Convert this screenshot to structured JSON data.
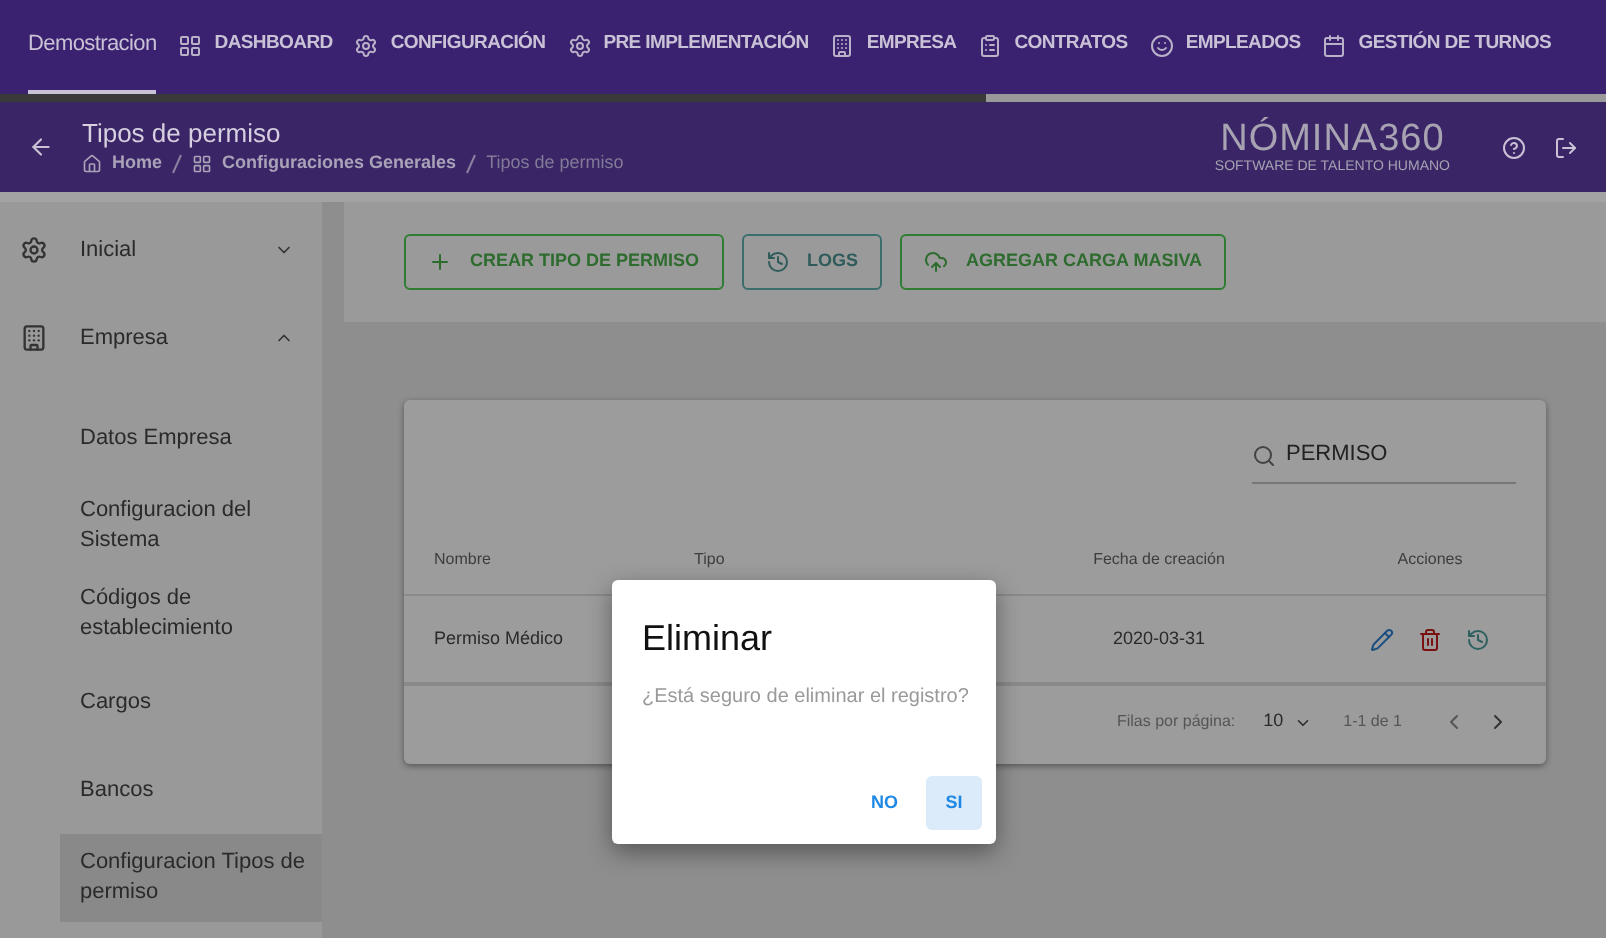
{
  "top_nav": {
    "tabs": [
      {
        "label": "Demostracion",
        "selected": true
      },
      {
        "label": "DASHBOARD",
        "selected": false
      },
      {
        "label": "CONFIGURACIÓN",
        "selected": false
      },
      {
        "label": "PRE IMPLEMENTACIÓN",
        "selected": false
      },
      {
        "label": "EMPRESA",
        "selected": false
      },
      {
        "label": "CONTRATOS",
        "selected": false
      },
      {
        "label": "EMPLEADOS",
        "selected": false
      },
      {
        "label": "GESTIÓN DE TURNOS",
        "selected": false
      }
    ]
  },
  "header": {
    "title": "Tipos de permiso",
    "breadcrumbs": [
      "Home",
      "Configuraciones Generales",
      "Tipos de permiso"
    ],
    "logo": {
      "wordmark": "NÓMINA360",
      "tagline": "SOFTWARE DE TALENTO HUMANO"
    }
  },
  "sidebar": {
    "items": [
      {
        "label": "Inicial",
        "expanded": false
      },
      {
        "label": "Empresa",
        "expanded": true,
        "children": [
          {
            "label": "Datos Empresa",
            "selected": false
          },
          {
            "label": "Configuracion del Sistema",
            "selected": false
          },
          {
            "label": "Códigos de establecimiento",
            "selected": false
          },
          {
            "label": "Cargos",
            "selected": false
          },
          {
            "label": "Bancos",
            "selected": false
          },
          {
            "label": "Configuracion Tipos de permiso",
            "selected": true
          }
        ]
      }
    ]
  },
  "toolbar": {
    "buttons": [
      "CREAR TIPO DE PERMISO",
      "LOGS",
      "AGREGAR CARGA MASIVA"
    ]
  },
  "table": {
    "search": {
      "value": "PERMISO"
    },
    "columns": [
      "Nombre",
      "Tipo",
      "Fecha de creación",
      "Acciones"
    ],
    "rows": [
      [
        "Permiso Médico",
        "",
        "2020-03-31"
      ]
    ],
    "pagination": {
      "rows_label": "Filas por página:",
      "rows_value": "10",
      "range": "1-1 de 1"
    }
  },
  "dialog": {
    "title": "Eliminar",
    "message": "¿Está seguro de eliminar el registro?",
    "buttons": [
      {
        "label": "NO",
        "selected": false
      },
      {
        "label": "SI",
        "selected": true
      }
    ]
  }
}
